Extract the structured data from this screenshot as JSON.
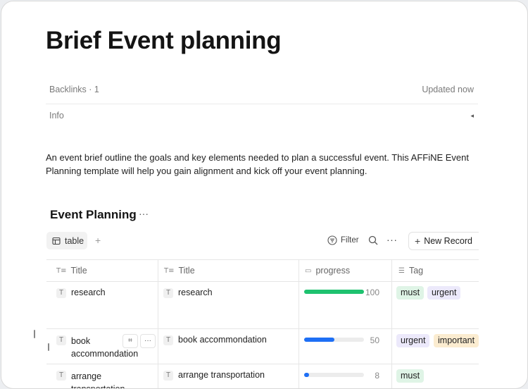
{
  "document": {
    "title": "Brief Event planning",
    "backlinks": "Backlinks · 1",
    "updated": "Updated now",
    "info": "Info",
    "info_toggle": "◂",
    "intro": "An event brief outline the goals and key elements needed to plan a successful event. This AFFiNE Event Planning template will help you gain alignment and kick off your event planning."
  },
  "database": {
    "title": "Event Planning",
    "more": "···",
    "view_tab": "table",
    "add_view": "+",
    "filter": "Filter",
    "more_actions": "···",
    "new_record_icon": "+",
    "new_record": "New Record",
    "columns": [
      {
        "label": "Title",
        "icon": "title-text-icon"
      },
      {
        "label": "Title",
        "icon": "title-text-icon"
      },
      {
        "label": "progress",
        "icon": "progress-icon"
      },
      {
        "label": "Tag",
        "icon": "multi-select-icon"
      }
    ],
    "rows": [
      {
        "title": "research",
        "title2": "research",
        "progress": 100,
        "progress_color": "#1ec26f",
        "tags": [
          {
            "label": "must",
            "color": "#dff4e6"
          },
          {
            "label": "urgent",
            "color": "#ece9fb"
          }
        ]
      },
      {
        "title": "book accommondation",
        "title2": "book accommondation",
        "progress": 50,
        "progress_color": "#1e6ff5",
        "tags": [
          {
            "label": "urgent",
            "color": "#ece9fb"
          },
          {
            "label": "important",
            "color": "#fbecd0"
          }
        ]
      },
      {
        "title": "arrange transportation",
        "title2": "arrange transportation",
        "progress": 8,
        "progress_color": "#1e6ff5",
        "tags": [
          {
            "label": "must",
            "color": "#dff4e6"
          }
        ]
      }
    ],
    "row_actions": {
      "expand_icon": "⌗",
      "more": "···"
    }
  },
  "colors": {
    "accent": "#1e6ff5",
    "success": "#1ec26f"
  }
}
